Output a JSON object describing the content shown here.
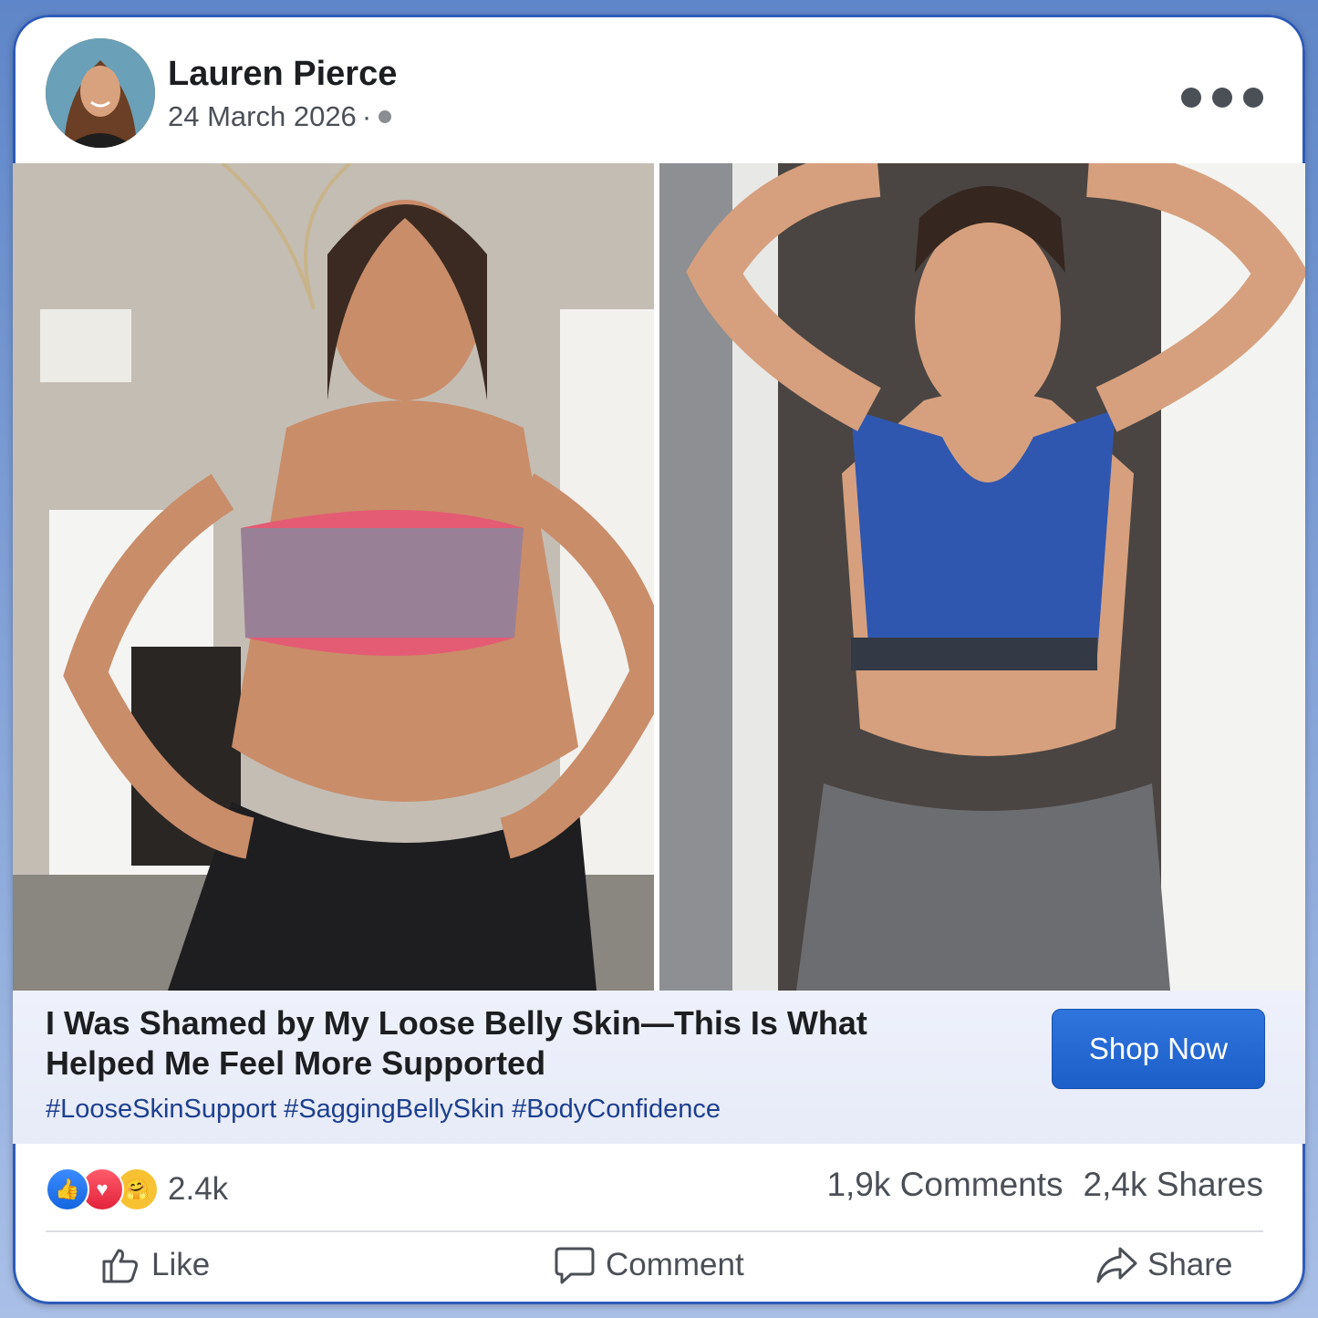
{
  "post": {
    "author": "Lauren Pierce",
    "date": "24 March 2026",
    "date_separator": "·",
    "privacy_icon": "globe-icon",
    "more_icon": "more-options-icon"
  },
  "ad": {
    "headline": "I Was Shamed by My Loose Belly Skin—This Is What Helped Me Feel More Supported",
    "hashtags": "#LooseSkinSupport #SaggingBellySkin #BodyConfidence",
    "cta_label": "Shop Now"
  },
  "engagement": {
    "reactions": [
      "like-reaction-icon",
      "love-reaction-icon",
      "care-reaction-icon"
    ],
    "reaction_count": "2.4k",
    "comments": "1,9k Comments",
    "shares": "2,4k Shares"
  },
  "actions": {
    "like": "Like",
    "comment": "Comment",
    "share": "Share"
  },
  "colors": {
    "cta": "#1d5fc9",
    "hashtag": "#1d3f8f",
    "frame": "#2e5bb8"
  }
}
